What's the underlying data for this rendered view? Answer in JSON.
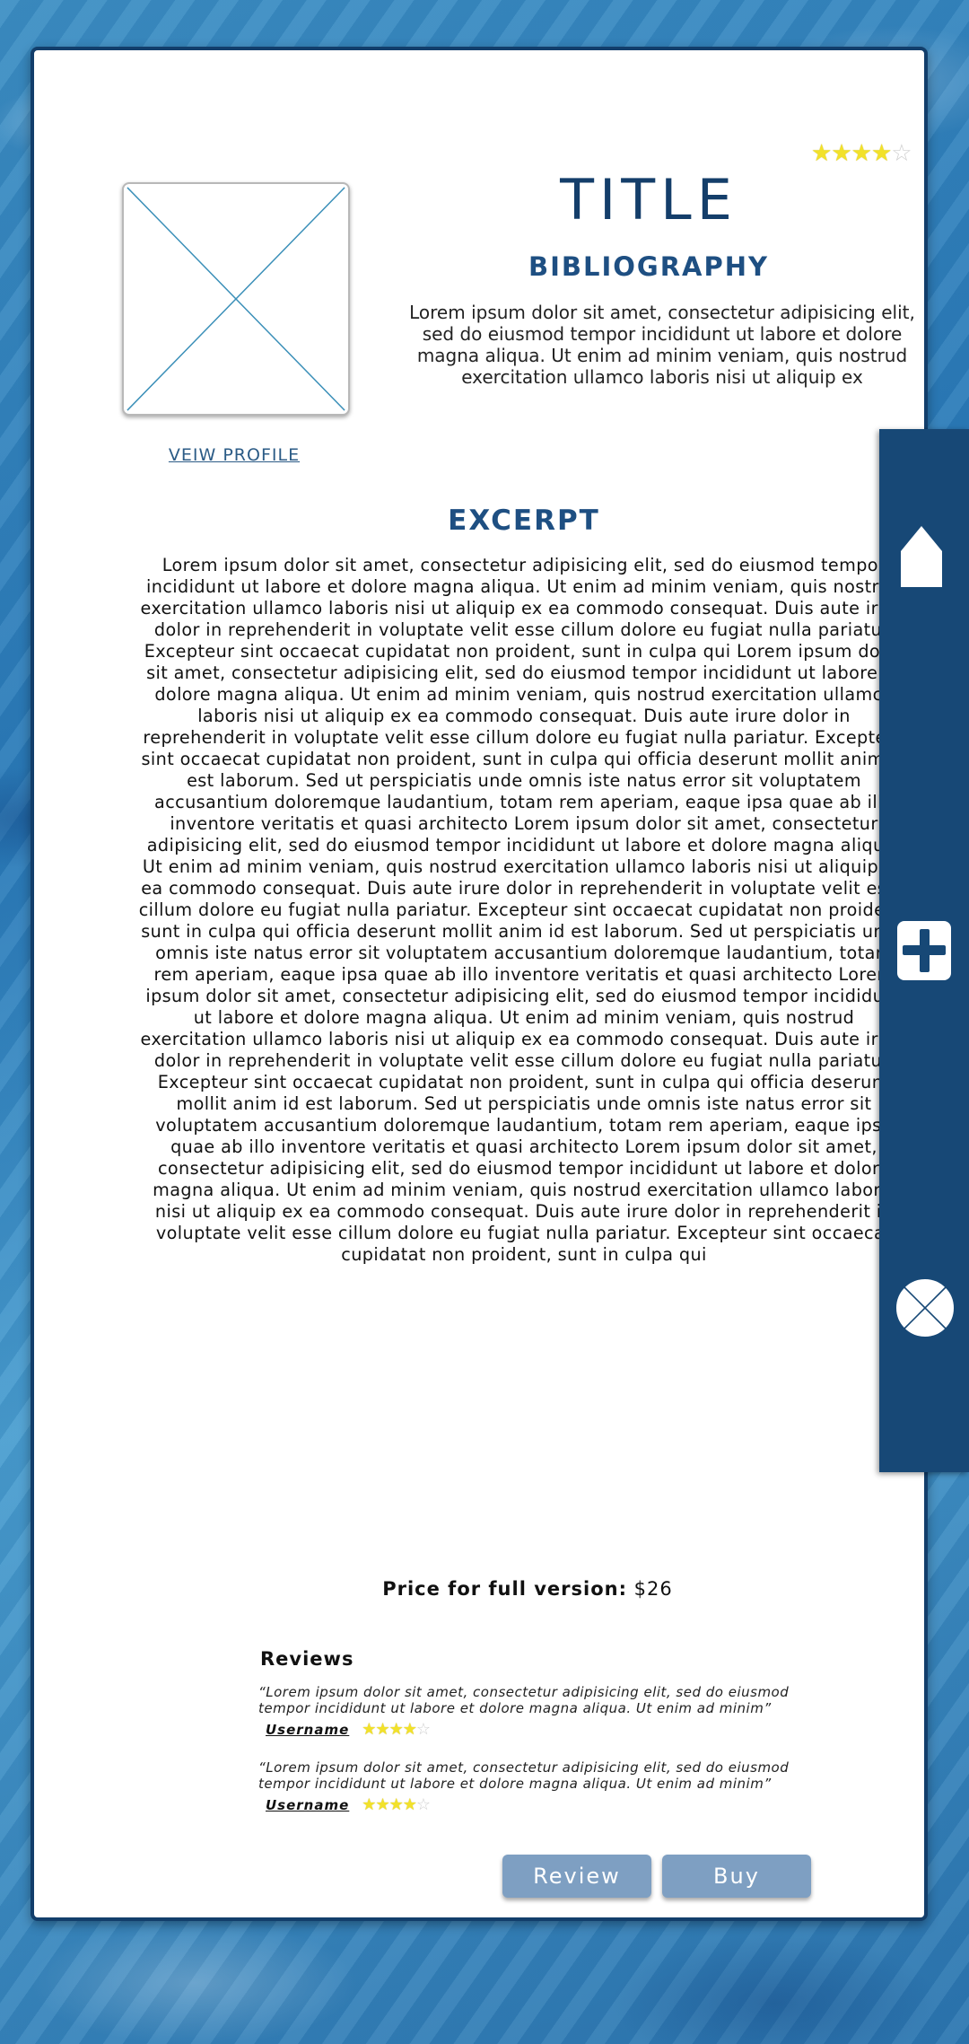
{
  "header": {
    "title": "TITLE",
    "bibliography_heading": "BIBLIOGRAPHY",
    "bibliography_text": "Lorem ipsum dolor sit amet, consectetur adipisicing elit, sed do eiusmod tempor incididunt ut labore et dolore magna aliqua. Ut enim ad minim veniam, quis nostrud exercitation ullamco laboris nisi ut aliquip ex",
    "rating": "4 of 5 stars"
  },
  "profile": {
    "image_icon": "image-placeholder-icon",
    "view_profile_label": "VEIW PROFILE"
  },
  "excerpt": {
    "heading": "EXCERPT",
    "text": "Lorem ipsum dolor sit amet, consectetur adipisicing elit, sed do eiusmod tempor incididunt ut labore et dolore magna aliqua. Ut enim ad minim veniam, quis nostrud exercitation ullamco laboris nisi ut aliquip ex ea commodo consequat. Duis aute irure dolor in reprehenderit in voluptate velit esse cillum dolore eu fugiat nulla pariatur. Excepteur sint occaecat cupidatat non proident, sunt in culpa qui Lorem ipsum dolor sit amet, consectetur adipisicing elit, sed do eiusmod tempor incididunt ut labore et dolore magna aliqua. Ut enim ad minim veniam, quis nostrud exercitation ullamco laboris nisi ut aliquip ex ea commodo consequat. Duis aute irure dolor in reprehenderit in voluptate velit esse cillum dolore eu fugiat nulla pariatur. Excepteur sint occaecat cupidatat non proident, sunt in culpa qui officia deserunt mollit anim id est laborum. Sed ut perspiciatis unde omnis iste natus error sit voluptatem accusantium doloremque laudantium, totam rem aperiam, eaque ipsa quae ab illo inventore veritatis et quasi architecto Lorem ipsum dolor sit amet, consectetur adipisicing elit, sed do eiusmod tempor incididunt ut labore et dolore magna aliqua. Ut enim ad minim veniam, quis nostrud exercitation ullamco laboris nisi ut aliquip ex ea commodo consequat. Duis aute irure dolor in reprehenderit in voluptate velit esse cillum dolore eu fugiat nulla pariatur. Excepteur sint occaecat cupidatat non proident, sunt in culpa qui officia deserunt mollit anim id est laborum. Sed ut perspiciatis unde omnis iste natus error sit voluptatem accusantium doloremque laudantium, totam rem aperiam, eaque ipsa quae ab illo inventore veritatis et quasi architecto Lorem ipsum dolor sit amet, consectetur adipisicing elit, sed do eiusmod tempor incididunt ut labore et dolore magna aliqua. Ut enim ad minim veniam, quis nostrud exercitation ullamco laboris nisi ut aliquip ex ea commodo consequat. Duis aute irure dolor in reprehenderit in voluptate velit esse cillum dolore eu fugiat nulla pariatur. Excepteur sint occaecat cupidatat non proident, sunt in culpa qui officia deserunt mollit anim id est laborum. Sed ut perspiciatis unde omnis iste natus error sit voluptatem accusantium doloremque laudantium, totam rem aperiam, eaque ipsa quae ab illo inventore veritatis et quasi architecto Lorem ipsum dolor sit amet, consectetur adipisicing elit, sed do eiusmod tempor incididunt ut labore et dolore magna aliqua. Ut enim ad minim veniam, quis nostrud exercitation ullamco laboris nisi ut aliquip ex ea commodo consequat. Duis aute irure dolor in reprehenderit in voluptate velit esse cillum dolore eu fugiat nulla pariatur. Excepteur sint occaecat cupidatat non proident, sunt in culpa qui"
  },
  "price": {
    "label": "Price for full version:",
    "value": "$26"
  },
  "reviews": {
    "heading": "Reviews",
    "items": [
      {
        "quote": "“Lorem ipsum dolor sit amet, consectetur adipisicing elit, sed do eiusmod tempor incididunt ut labore et dolore magna aliqua. Ut enim ad minim”",
        "username": "Username",
        "rating": 4
      },
      {
        "quote": "“Lorem ipsum dolor sit amet, consectetur adipisicing elit, sed do eiusmod tempor incididunt ut labore et dolore magna aliqua. Ut enim ad minim”",
        "username": "Username",
        "rating": 4
      }
    ]
  },
  "actions": {
    "review_label": "Review",
    "buy_label": "Buy"
  },
  "sidebar": {
    "icons": [
      "home-icon",
      "plus-icon",
      "close-icon"
    ]
  },
  "colors": {
    "primary_dark": "#174876",
    "heading_blue": "#1e4f82",
    "button_blue": "#7e9fc2",
    "star_yellow": "#f2e12a",
    "card_bg": "#ffffff"
  }
}
